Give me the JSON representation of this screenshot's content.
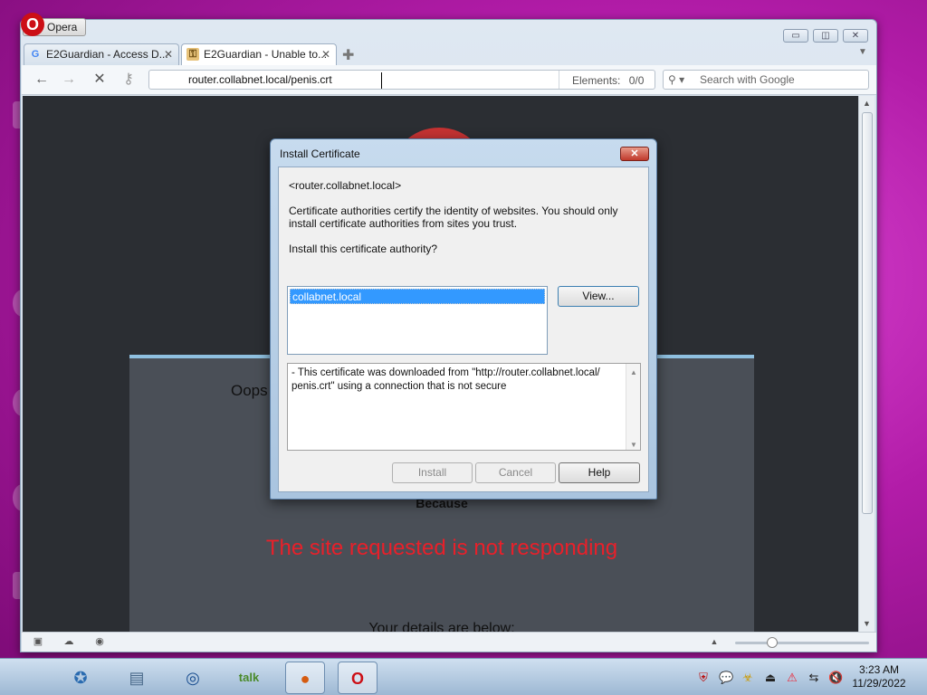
{
  "browser": {
    "app_name": "Opera",
    "tabs": [
      {
        "label": "E2Guardian - Access D...",
        "favicon": "G"
      },
      {
        "label": "E2Guardian - Unable to...",
        "favicon": "key"
      }
    ],
    "address": "router.collabnet.local/penis.crt",
    "elements_label": "Elements:",
    "elements_value": "0/0",
    "search_placeholder": "Search with Google"
  },
  "page": {
    "oops_text": "Oops",
    "because_text": "Because",
    "error_text": "The site requested is not responding",
    "details_text": "Your details are below:"
  },
  "dialog": {
    "title": "Install Certificate",
    "host": "<router.collabnet.local>",
    "line1": "Certificate authorities certify the identity of websites. You should only",
    "line2": "install certificate authorities from sites you trust.",
    "question": "Install this certificate authority?",
    "list_items": [
      "collabnet.local"
    ],
    "view_button": "View...",
    "warning_line1": "- This certificate was downloaded from \"http://router.collabnet.local/",
    "warning_line2": "penis.crt\" using a connection that is not secure",
    "install_button": "Install",
    "cancel_button": "Cancel",
    "help_button": "Help"
  },
  "taskbar": {
    "time": "3:23 AM",
    "date": "11/29/2022"
  }
}
